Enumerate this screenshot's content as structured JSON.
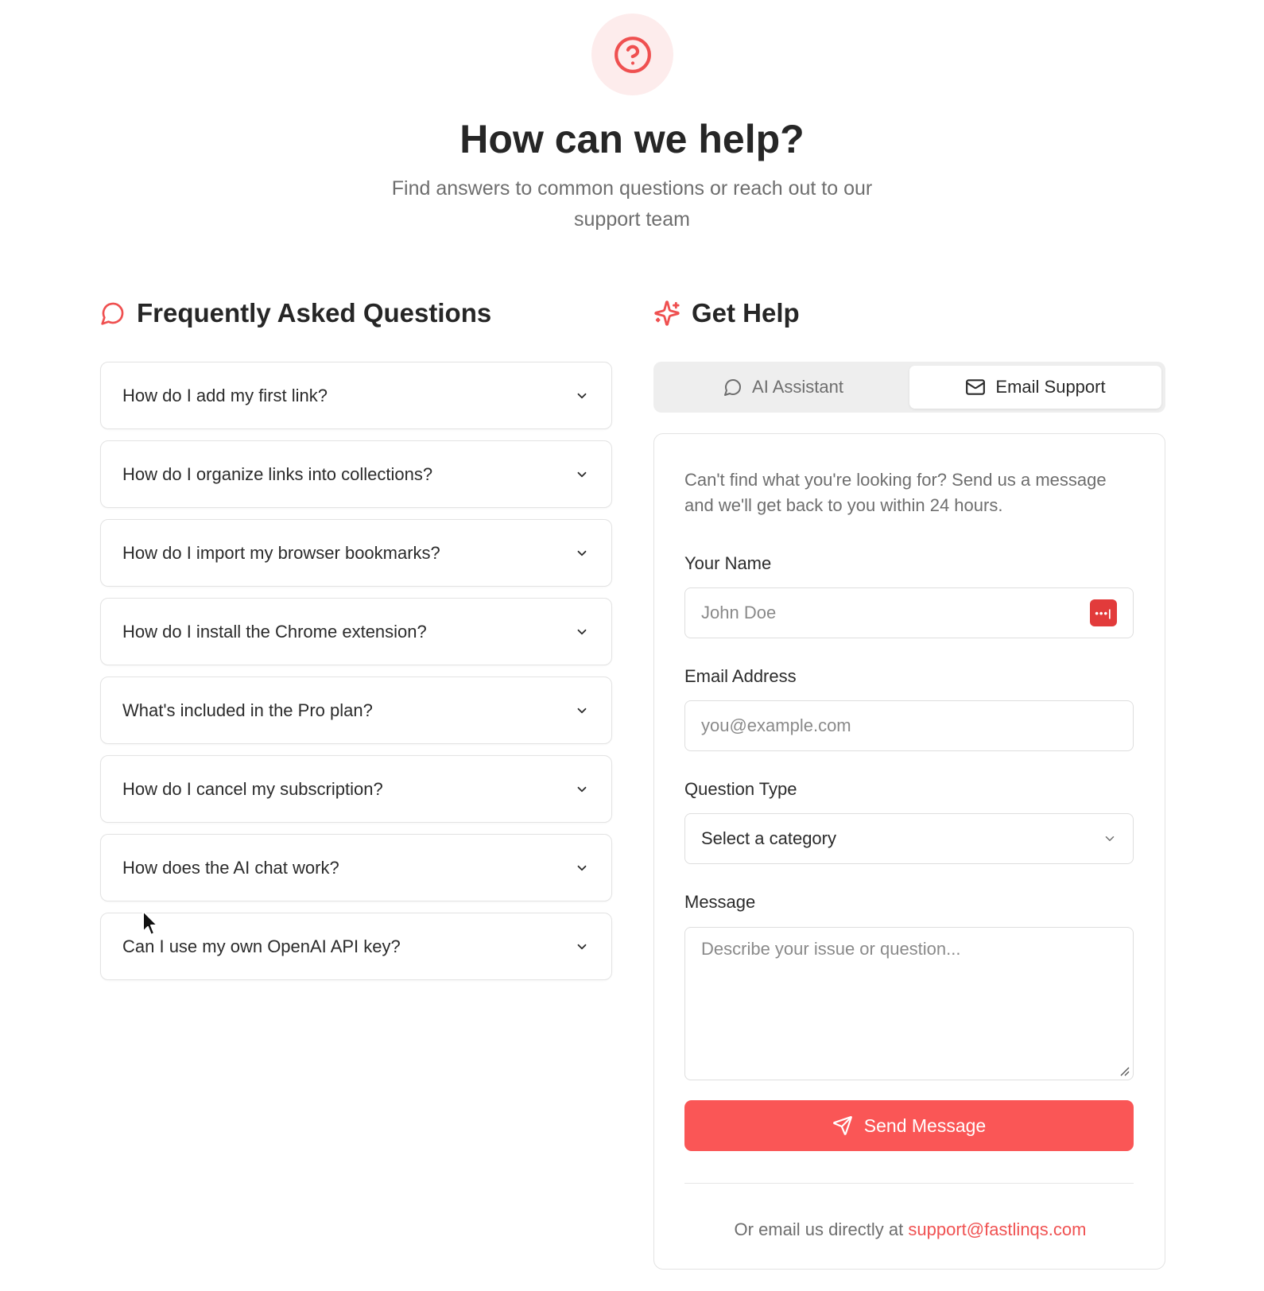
{
  "hero": {
    "title": "How can we help?",
    "subtitle": "Find answers to common questions or reach out to our support team",
    "icon": "question-circle-icon",
    "accent": "#ef5050"
  },
  "faq": {
    "heading": "Frequently Asked Questions",
    "icon": "chat-bubble-icon",
    "items": [
      {
        "question": "How do I add my first link?"
      },
      {
        "question": "How do I organize links into collections?"
      },
      {
        "question": "How do I import my browser bookmarks?"
      },
      {
        "question": "How do I install the Chrome extension?"
      },
      {
        "question": "What's included in the Pro plan?"
      },
      {
        "question": "How do I cancel my subscription?"
      },
      {
        "question": "How does the AI chat work?"
      },
      {
        "question": "Can I use my own OpenAI API key?"
      }
    ]
  },
  "help": {
    "heading": "Get Help",
    "icon": "sparkle-icon",
    "tabs": [
      {
        "label": "AI Assistant",
        "icon": "chat-bubble-icon",
        "active": false
      },
      {
        "label": "Email Support",
        "icon": "mail-icon",
        "active": true
      }
    ],
    "form": {
      "intro": "Can't find what you're looking for? Send us a message and we'll get back to you within 24 hours.",
      "name_label": "Your Name",
      "name_placeholder": "John Doe",
      "email_label": "Email Address",
      "email_placeholder": "you@example.com",
      "type_label": "Question Type",
      "type_value": "Select a category",
      "message_label": "Message",
      "message_placeholder": "Describe your issue or question...",
      "submit_label": "Send Message",
      "submit_color": "#fa5656"
    },
    "footer": {
      "prefix": "Or email us directly at",
      "email": "support@fastlinqs.com"
    }
  }
}
